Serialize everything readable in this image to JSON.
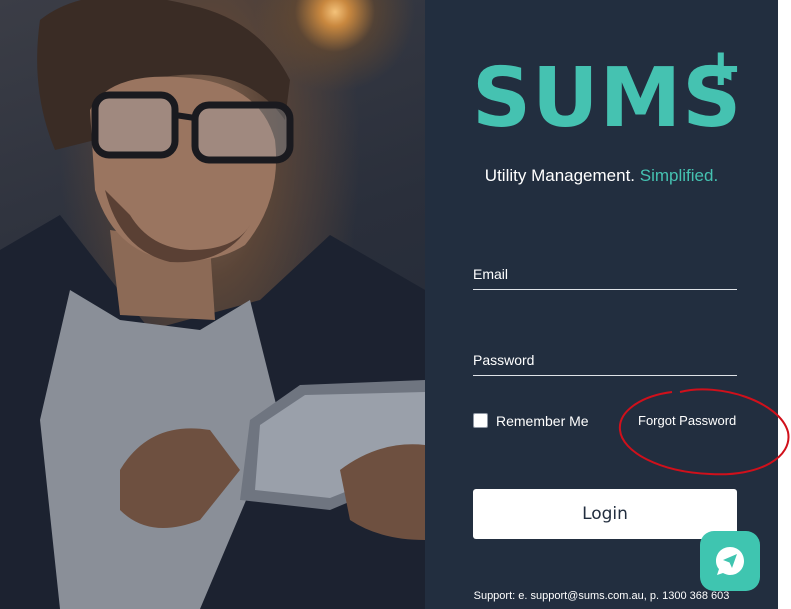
{
  "brand": {
    "logo_text": "SUMS",
    "logo_plus": "+",
    "tagline_main": "Utility Management.",
    "tagline_accent": "Simplified.",
    "accent_color": "#45c2b1",
    "panel_color": "#222e3f"
  },
  "form": {
    "email_label": "Email",
    "email_value": "",
    "password_label": "Password",
    "password_value": "",
    "remember_label": "Remember Me",
    "remember_checked": false,
    "forgot_label": "Forgot Password",
    "login_label": "Login"
  },
  "chat": {
    "icon": "send-message-icon"
  },
  "footer": {
    "support_text": "Support: e. support@sums.com.au, p. 1300 368 603"
  },
  "annotation": {
    "color": "#d0101b",
    "target": "Forgot Password"
  }
}
